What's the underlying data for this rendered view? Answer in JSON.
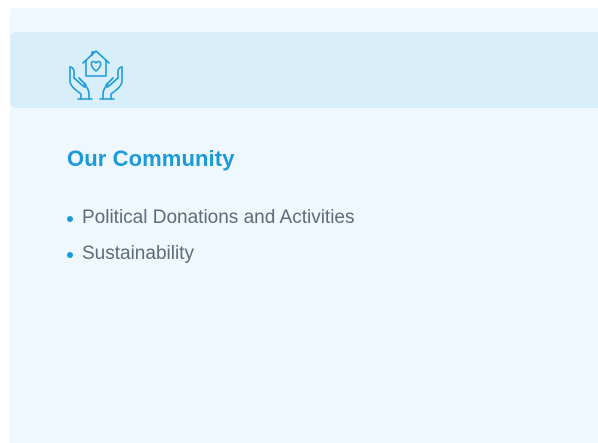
{
  "card": {
    "icon": "hands-holding-house-heart-icon",
    "title": "Our Community",
    "links": [
      {
        "label": "Political Donations and Activities",
        "icon": "bullet-dot-icon"
      },
      {
        "label": "Sustainability",
        "icon": "bullet-dot-icon"
      }
    ]
  },
  "colors": {
    "accent": "#1a9ad8",
    "card_background": "#eef8fe",
    "header_background": "#d8effb",
    "link_text": "#5f6b73"
  }
}
